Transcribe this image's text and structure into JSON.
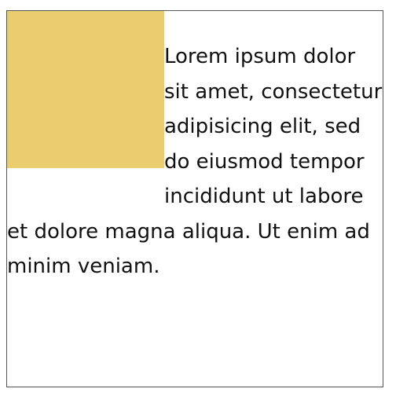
{
  "content": {
    "paragraph": "Lorem ipsum dolor sit amet, consectetur adipisicing elit, sed do eiusmod tempor incididunt ut labore et dolore magna aliqua. Ut enim ad minim veniam."
  },
  "colors": {
    "float_box": "#eacd6f",
    "border": "#555555",
    "text": "#111111",
    "background": "#ffffff"
  }
}
